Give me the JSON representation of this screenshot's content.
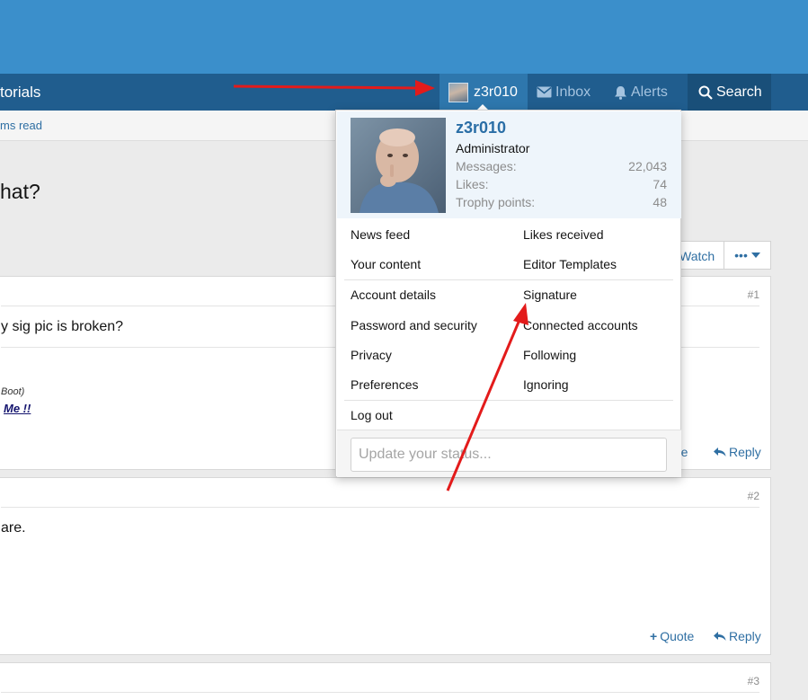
{
  "nav": {
    "left_partial": "torials",
    "user_label": "z3r010",
    "inbox_label": "Inbox",
    "alerts_label": "Alerts",
    "search_label": "Search"
  },
  "subnav": {
    "link": "ms read"
  },
  "thread": {
    "title_partial": "hat?",
    "watch_label": "Watch",
    "more_label": "•••"
  },
  "posts": [
    {
      "num": "#1",
      "text": "y sig pic is broken?",
      "sig1": "Boot)",
      "sig2": "Me !!",
      "quote": "ote",
      "reply": "Reply"
    },
    {
      "num": "#2",
      "text": "are.",
      "quote": "Quote",
      "reply": "Reply"
    },
    {
      "num": "#3"
    }
  ],
  "popup": {
    "name": "z3r010",
    "role": "Administrator",
    "stats": [
      {
        "label": "Messages:",
        "value": "22,043"
      },
      {
        "label": "Likes:",
        "value": "74"
      },
      {
        "label": "Trophy points:",
        "value": "48"
      }
    ],
    "menu": {
      "news_feed": "News feed",
      "likes_received": "Likes received",
      "your_content": "Your content",
      "editor_templates": "Editor Templates",
      "account_details": "Account details",
      "signature": "Signature",
      "password_security": "Password and security",
      "connected_accounts": "Connected accounts",
      "privacy": "Privacy",
      "following": "Following",
      "preferences": "Preferences",
      "ignoring": "Ignoring",
      "log_out": "Log out"
    },
    "status_placeholder": "Update your status..."
  },
  "colors": {
    "header": "#3b8fcb",
    "navbar": "#205d8e",
    "link": "#2f6fa3",
    "annotation_arrow": "#e31b1b"
  }
}
